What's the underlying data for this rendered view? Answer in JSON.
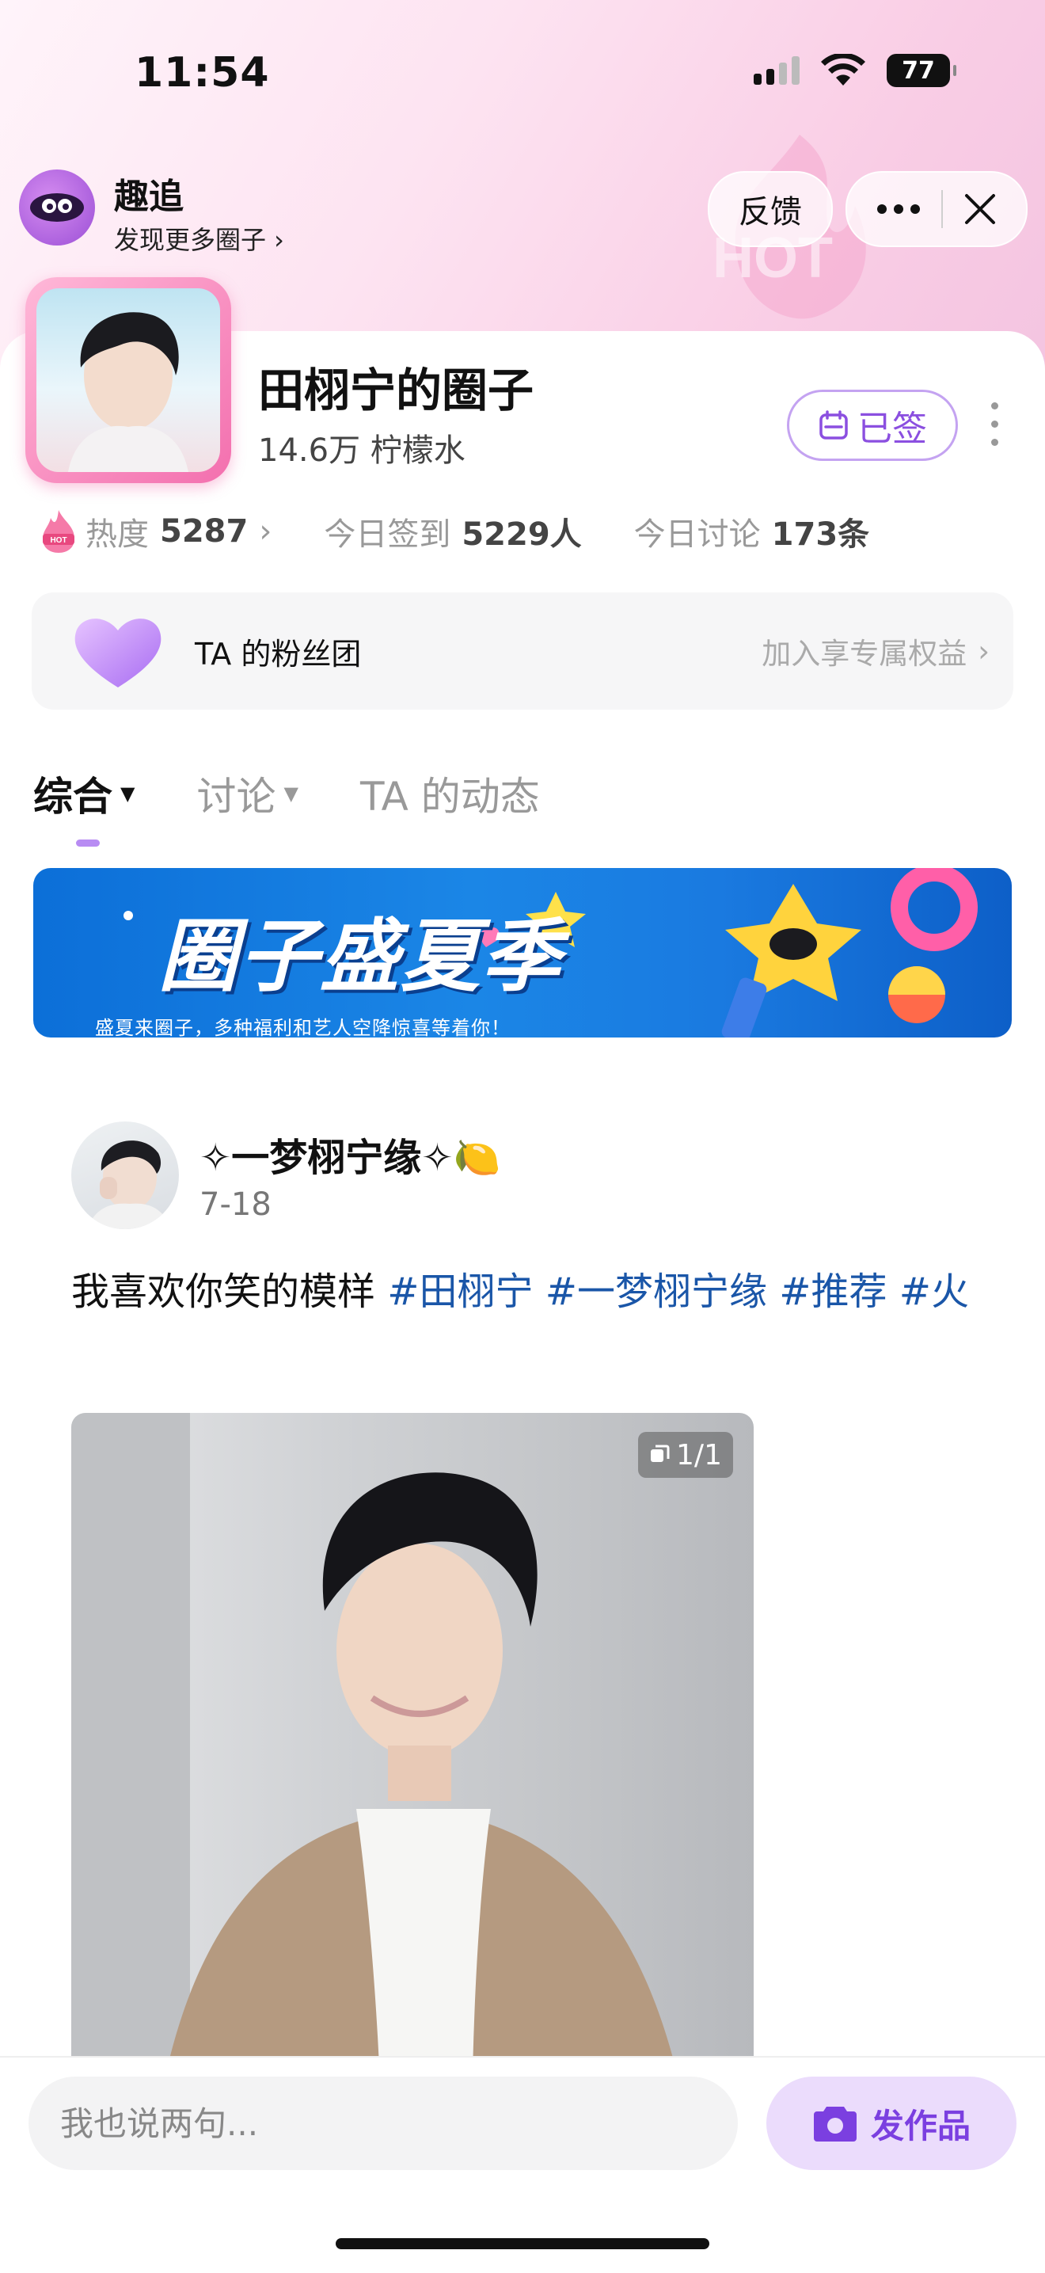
{
  "status_bar": {
    "time": "11:54",
    "battery": "77"
  },
  "app": {
    "name": "趣追",
    "subtitle": "发现更多圈子 ›",
    "feedback_label": "反馈"
  },
  "circle": {
    "title": "田栩宁的圈子",
    "members": "14.6万 柠檬水",
    "signed_label": "已签",
    "stats": {
      "heat_label": "热度",
      "heat_value": "5287",
      "checkin_label": "今日签到",
      "checkin_value": "5229人",
      "discuss_label": "今日讨论",
      "discuss_value": "173条"
    },
    "fan_club": {
      "label": "TA 的粉丝团",
      "action": "加入享专属权益"
    }
  },
  "tabs": [
    {
      "label": "综合",
      "active": true
    },
    {
      "label": "讨论",
      "active": false
    },
    {
      "label": "TA 的动态",
      "active": false
    }
  ],
  "banner": {
    "title": "圈子盛夏季",
    "subtitle": "盛夏来圈子，多种福利和艺人空降惊喜等着你！"
  },
  "post": {
    "author": "✧一梦栩宁缘✧🍋",
    "date": "7-18",
    "text": "我喜欢你笑的模样",
    "tags": [
      "#田栩宁",
      "#一梦栩宁缘",
      "#推荐",
      "#火"
    ],
    "image_count": "1/1"
  },
  "bottom": {
    "comment_placeholder": "我也说两句...",
    "publish_label": "发作品"
  },
  "colors": {
    "accent": "#8b4fe0",
    "tag": "#1a56a8",
    "pink": "#f36fae"
  }
}
